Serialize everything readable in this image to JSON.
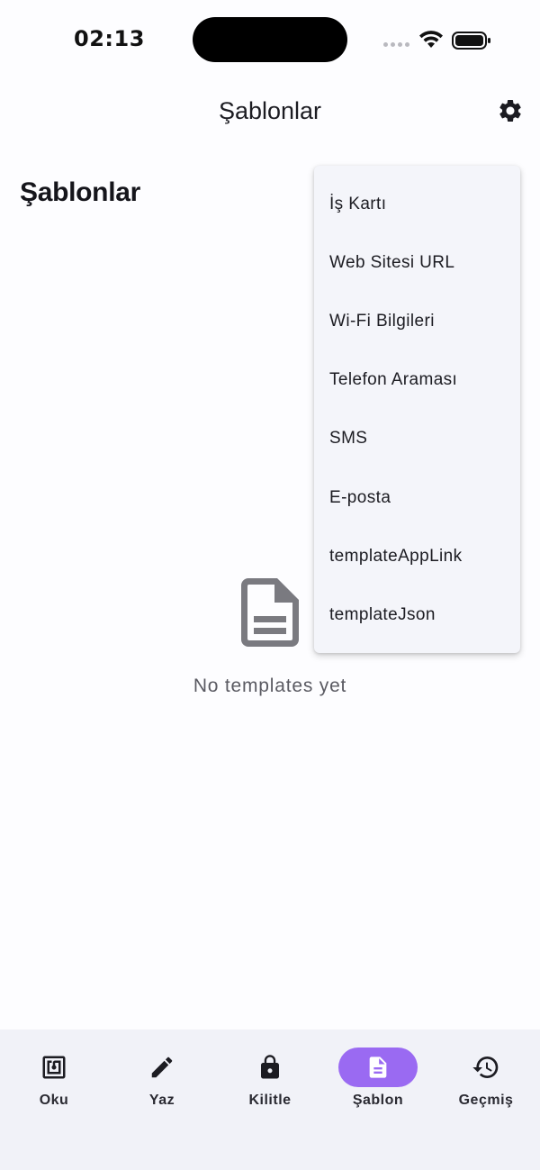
{
  "status_bar": {
    "time": "02:13"
  },
  "app_bar": {
    "title": "Şablonlar",
    "settings_icon": "gear-icon"
  },
  "page": {
    "heading": "Şablonlar",
    "empty_icon": "document-icon",
    "empty_text": "No templates yet"
  },
  "dropdown": {
    "items": [
      {
        "label": "İş Kartı"
      },
      {
        "label": "Web Sitesi URL"
      },
      {
        "label": "Wi-Fi Bilgileri"
      },
      {
        "label": "Telefon Araması"
      },
      {
        "label": "SMS"
      },
      {
        "label": "E-posta"
      },
      {
        "label": "templateAppLink"
      },
      {
        "label": "templateJson"
      }
    ]
  },
  "bottom_nav": {
    "active_color": "#9a6af2",
    "items": [
      {
        "label": "Oku",
        "icon": "nfc-icon"
      },
      {
        "label": "Yaz",
        "icon": "pencil-icon"
      },
      {
        "label": "Kilitle",
        "icon": "lock-icon"
      },
      {
        "label": "Şablon",
        "icon": "document-icon",
        "active": true
      },
      {
        "label": "Geçmiş",
        "icon": "history-icon"
      }
    ]
  }
}
